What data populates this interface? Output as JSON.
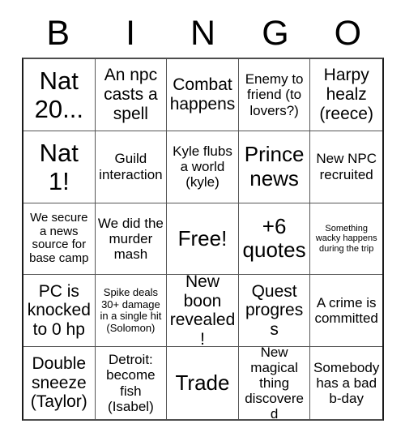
{
  "card": {
    "header_letters": [
      "B",
      "I",
      "N",
      "G",
      "O"
    ],
    "rows": [
      [
        {
          "text": "Nat 20...",
          "size": "fs-xxl"
        },
        {
          "text": "An npc casts a spell",
          "size": "fs-l"
        },
        {
          "text": "Combat happens",
          "size": "fs-l"
        },
        {
          "text": "Enemy to friend (to lovers?)",
          "size": "fs-m"
        },
        {
          "text": "Harpy healz (reece)",
          "size": "fs-l"
        }
      ],
      [
        {
          "text": "Nat 1!",
          "size": "fs-xxl"
        },
        {
          "text": "Guild interaction",
          "size": "fs-m"
        },
        {
          "text": "Kyle flubs a world (kyle)",
          "size": "fs-m"
        },
        {
          "text": "Prince news",
          "size": "fs-xl"
        },
        {
          "text": "New NPC recruited",
          "size": "fs-m"
        }
      ],
      [
        {
          "text": "We secure a news source for base camp",
          "size": "fs-s"
        },
        {
          "text": "We did the murder mash",
          "size": "fs-m"
        },
        {
          "text": "Free!",
          "size": "fs-xl"
        },
        {
          "text": "+6 quotes",
          "size": "fs-xl"
        },
        {
          "text": "Something wacky happens during the trip",
          "size": "fs-xxs"
        }
      ],
      [
        {
          "text": "PC is knocked to 0 hp",
          "size": "fs-l"
        },
        {
          "text": "Spike deals 30+ damage in a single hit (Solomon)",
          "size": "fs-xs"
        },
        {
          "text": "New boon revealed!",
          "size": "fs-l"
        },
        {
          "text": "Quest progress",
          "size": "fs-l"
        },
        {
          "text": "A crime is committed",
          "size": "fs-m"
        }
      ],
      [
        {
          "text": "Double sneeze (Taylor)",
          "size": "fs-l"
        },
        {
          "text": "Detroit: become fish (Isabel)",
          "size": "fs-m"
        },
        {
          "text": "Trade",
          "size": "fs-xl"
        },
        {
          "text": "New magical thing discovered",
          "size": "fs-m"
        },
        {
          "text": "Somebody has a bad b-day",
          "size": "fs-m"
        }
      ]
    ],
    "free_space_index": {
      "row": 2,
      "col": 2
    },
    "colors": {
      "background": "#ffffff",
      "text": "#000000",
      "grid_line": "#555555",
      "grid_border": "#1a1a1a"
    }
  }
}
